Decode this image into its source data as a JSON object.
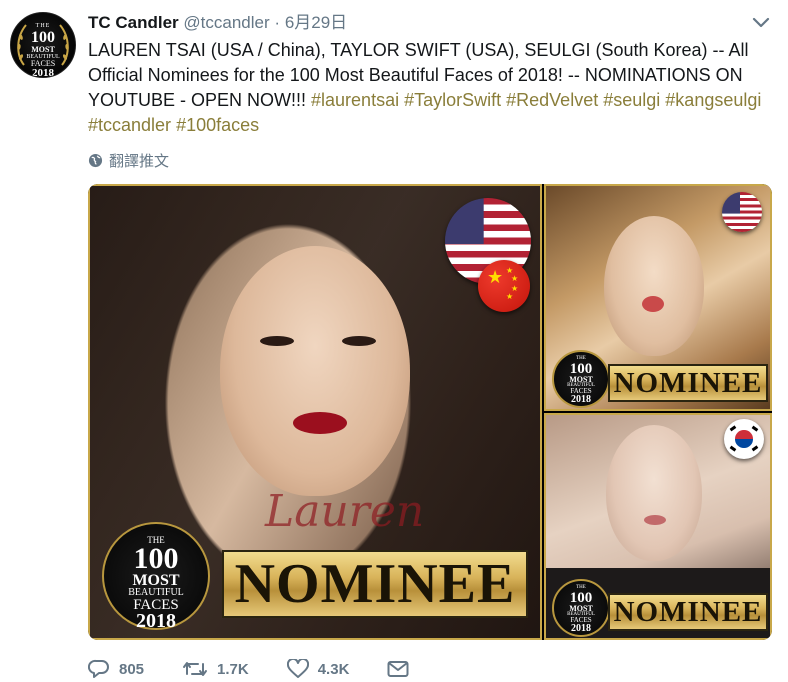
{
  "tweet": {
    "author_name": "TC Candler",
    "handle": "@tccandler",
    "separator": "·",
    "date": "6月29日",
    "text_parts": [
      {
        "t": "LAUREN TSAI (USA / China), TAYLOR SWIFT (USA), SEULGI (South Korea) -- All Official Nominees for the 100 Most Beautiful Faces of 2018! -- NOMINATIONS ON YOUTUBE - OPEN NOW!!! ",
        "hash": false
      },
      {
        "t": "#laurentsai",
        "hash": true
      },
      {
        "t": " ",
        "hash": false
      },
      {
        "t": "#TaylorSwift",
        "hash": true
      },
      {
        "t": " ",
        "hash": false
      },
      {
        "t": "#RedVelvet",
        "hash": true
      },
      {
        "t": " ",
        "hash": false
      },
      {
        "t": "#seulgi",
        "hash": true
      },
      {
        "t": " ",
        "hash": false
      },
      {
        "t": "#kangseulgi",
        "hash": true
      },
      {
        "t": " ",
        "hash": false
      },
      {
        "t": "#tccandler",
        "hash": true
      },
      {
        "t": " ",
        "hash": false
      },
      {
        "t": "#100faces",
        "hash": true
      }
    ],
    "translate_label": "翻譯推文",
    "avatar_lines": [
      "THE",
      "100",
      "MOST",
      "BEAUTIFUL",
      "FACES",
      "2018"
    ],
    "badge_lines": [
      "THE",
      "100",
      "MOST",
      "BEAUTIFUL",
      "FACES",
      "2018"
    ],
    "nominee_label": "NOMINEE",
    "watermark_signature": "Lauren",
    "actions": {
      "reply_count": "805",
      "retweet_count": "1.7K",
      "like_count": "4.3K"
    },
    "colors": {
      "hashtag": "#8a7e3a",
      "muted": "#657786",
      "gold": "#c8a84a"
    }
  }
}
